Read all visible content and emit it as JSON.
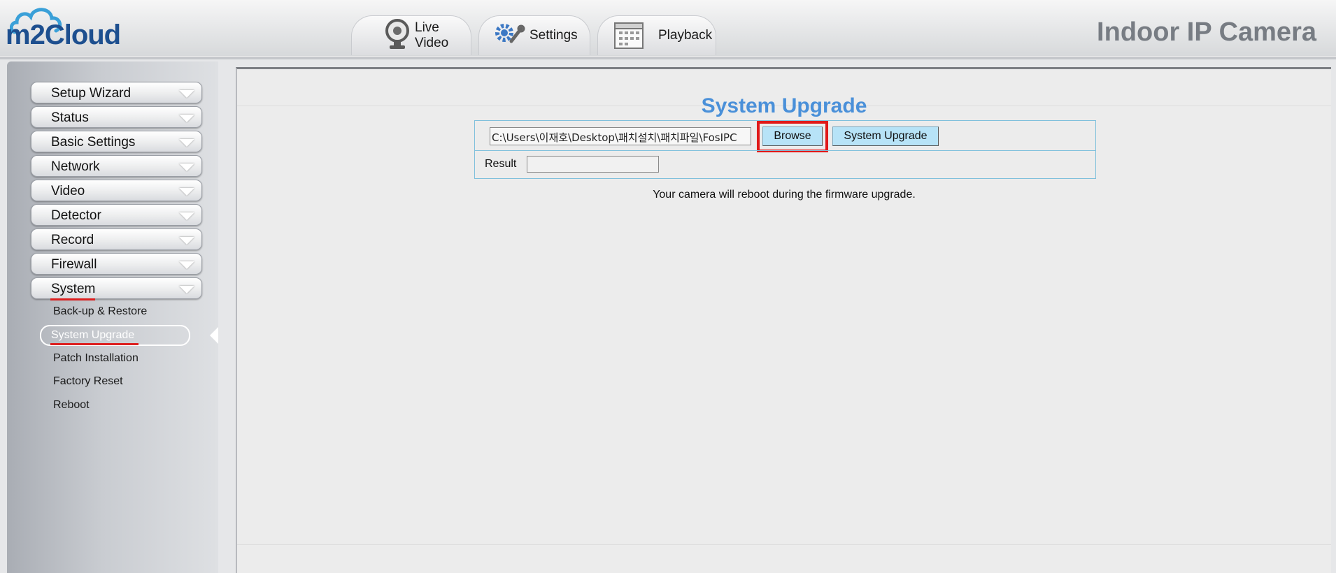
{
  "header": {
    "logo_text": "m2Cloud",
    "product_title": "Indoor IP Camera",
    "tabs": [
      {
        "label": "Live Video",
        "icon": "webcam-icon"
      },
      {
        "label": "Settings",
        "icon": "gears-icon"
      },
      {
        "label": "Playback",
        "icon": "calendar-icon"
      }
    ]
  },
  "sidebar": {
    "menu": [
      {
        "label": "Setup Wizard"
      },
      {
        "label": "Status"
      },
      {
        "label": "Basic Settings"
      },
      {
        "label": "Network"
      },
      {
        "label": "Video"
      },
      {
        "label": "Detector"
      },
      {
        "label": "Record"
      },
      {
        "label": "Firewall"
      },
      {
        "label": "System"
      }
    ],
    "system_submenu": [
      {
        "label": "Back-up & Restore"
      },
      {
        "label": "System Upgrade",
        "active": true
      },
      {
        "label": "Patch Installation"
      },
      {
        "label": "Factory Reset"
      },
      {
        "label": "Reboot"
      }
    ]
  },
  "main": {
    "title": "System Upgrade",
    "file_path": "C:\\Users\\이재호\\Desktop\\패치설치\\패치파일\\FosIPC",
    "browse_label": "Browse",
    "upgrade_label": "System Upgrade",
    "result_label": "Result",
    "result_value": "",
    "note": "Your camera will reboot during the firmware upgrade."
  },
  "colors": {
    "accent_title": "#4a90d9",
    "button_bg": "#b7e3f7",
    "highlight": "#e01919",
    "logo": "#1d4f8f"
  }
}
